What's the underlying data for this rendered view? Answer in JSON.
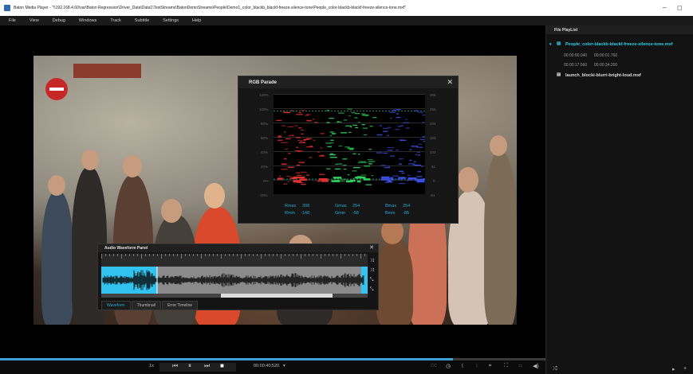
{
  "titlebar": {
    "title": "Baton Media Player - \"\\\\192.168.4.60\\var\\Baton Regression\\Driver_Data\\Data1\\TestStreams\\BatonDemoStreams\\People\\Demo1_color_blackb_blackf-freeze-silence-tone\\People_color-blackb-blackf-freeze-silence-tone.mxf\"",
    "minimize": "–",
    "restore": "◻"
  },
  "menu": [
    "File",
    "View",
    "Debug",
    "Windows",
    "Track",
    "Subtitle",
    "Settings",
    "Help"
  ],
  "rgb_parade": {
    "title": "RGB Parade",
    "close": "✕",
    "y_left": [
      "120%",
      "100%",
      "80%",
      "60%",
      "40%",
      "20%",
      "0%",
      "-20%"
    ],
    "y_right": [
      "306",
      "255",
      "204",
      "153",
      "102",
      "51",
      "0",
      "-51"
    ],
    "stats": {
      "rmax_label": "Rmax",
      "rmax": "308",
      "rmin_label": "Rmin",
      "rmin": "-148",
      "gmax_label": "Gmax",
      "gmax": "254",
      "gmin_label": "Gmin",
      "gmin": "-58",
      "bmax_label": "Bmax",
      "bmax": "254",
      "bmin_label": "Bmin",
      "bmin": "-85"
    },
    "colors": {
      "red": "#e03030",
      "green": "#2fd15a",
      "blue": "#3a4fe0",
      "ref": "#2ac4a8"
    }
  },
  "audio_waveform": {
    "title": "Audio Waveform Panel",
    "close": "✕",
    "tabs": [
      "Waveform",
      "Thumbnail",
      "Error Timeline"
    ],
    "active_tab": 0,
    "selection_color": "#32c3f0"
  },
  "controls": {
    "speed": "1x",
    "timecode": "00:00:40;520",
    "timecode_caret": "▾",
    "progress": 0.83
  },
  "sidebar": {
    "title": "File PlayList",
    "files": [
      {
        "name": "People_color-blackb-blackf-freeze-silence-tone.mxf",
        "active": true,
        "segments": [
          {
            "start": "00:00:00.040",
            "end": "00:00:01.760"
          },
          {
            "start": "00:00:17.560",
            "end": "00:00:34.200"
          }
        ]
      },
      {
        "name": "launch_blocki-blurri-bright-loud.mxf",
        "active": false,
        "segments": []
      }
    ],
    "active_color": "#2bd1e8",
    "bottom_play": "▸",
    "bottom_add": "+"
  }
}
